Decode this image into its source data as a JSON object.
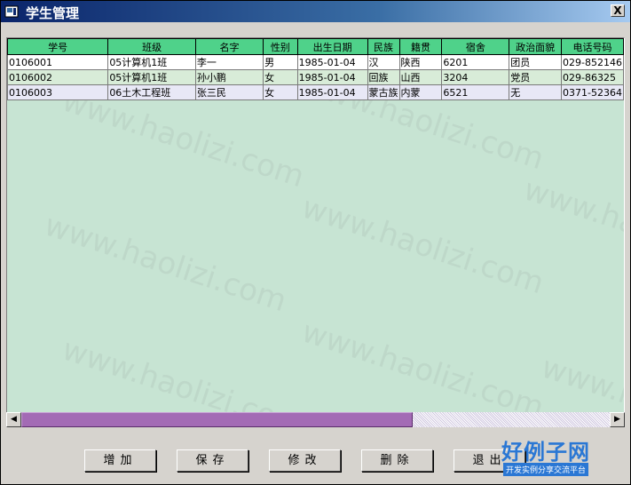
{
  "window": {
    "title": "学生管理",
    "close_label": "X"
  },
  "grid": {
    "columns": [
      "学号",
      "班级",
      "名字",
      "性别",
      "出生日期",
      "民族",
      "籍贯",
      "宿舍",
      "政治面貌",
      "电话号码"
    ],
    "rows": [
      [
        "0106001",
        "05计算机1班",
        "李一",
        "男",
        "1985-01-04",
        "汉",
        "陕西",
        "6201",
        "团员",
        "029-852146"
      ],
      [
        "0106002",
        "05计算机1班",
        "孙小鹏",
        "女",
        "1985-01-04",
        "回族",
        "山西",
        "3204",
        "党员",
        "029-86325"
      ],
      [
        "0106003",
        "06土木工程班",
        "张三民",
        "女",
        "1985-01-04",
        "蒙古族",
        "内蒙",
        "6521",
        "无",
        "0371-52364"
      ]
    ]
  },
  "watermark": "www.haolizi.com",
  "buttons": {
    "add": "增加",
    "save": "保存",
    "edit": "修改",
    "delete": "删除",
    "exit": "退出"
  },
  "logo": {
    "main": "好例子网",
    "sub": "开发实例分享交流平台"
  },
  "colors": {
    "header_bg": "#4fd28a",
    "grid_bg": "#c7e4d3",
    "scroll_thumb": "#a36bb5",
    "logo_blue": "#2a77d4"
  }
}
